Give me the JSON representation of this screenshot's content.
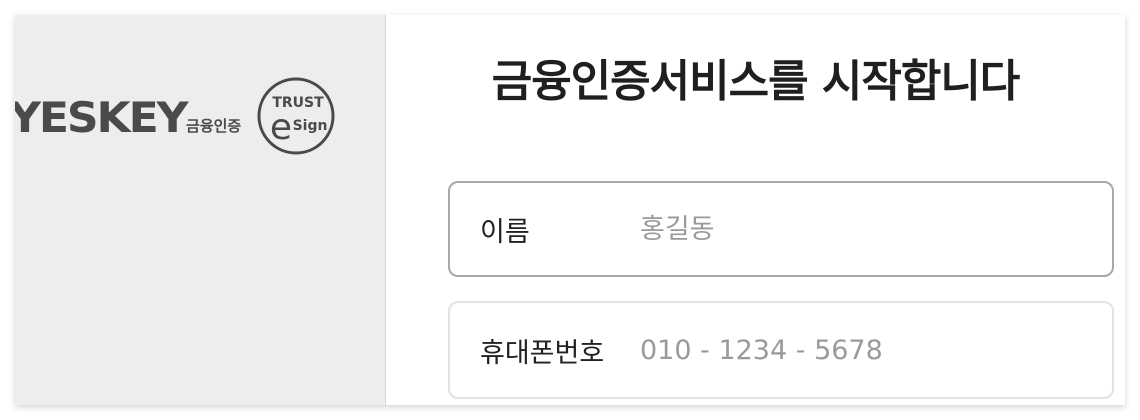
{
  "brand": {
    "yeskey_logo": "YESKEY",
    "yeskey_subtitle": "금융인증",
    "trust_logo_top": "TRUST",
    "trust_logo_letter": "e",
    "trust_logo_bottom": "Sign"
  },
  "main": {
    "title": "금융인증서비스를 시작합니다"
  },
  "form": {
    "name": {
      "label": "이름",
      "placeholder": "홍길동",
      "value": ""
    },
    "phone": {
      "label": "휴대폰번호",
      "placeholder": "010 - 1234 - 5678",
      "value": ""
    }
  },
  "colors": {
    "brand_gray": "#4a4a4a",
    "panel_bg": "#ededed",
    "active_border": "#a8a8a8",
    "inactive_border": "#e2e2e2",
    "placeholder": "#9a9a9a"
  }
}
